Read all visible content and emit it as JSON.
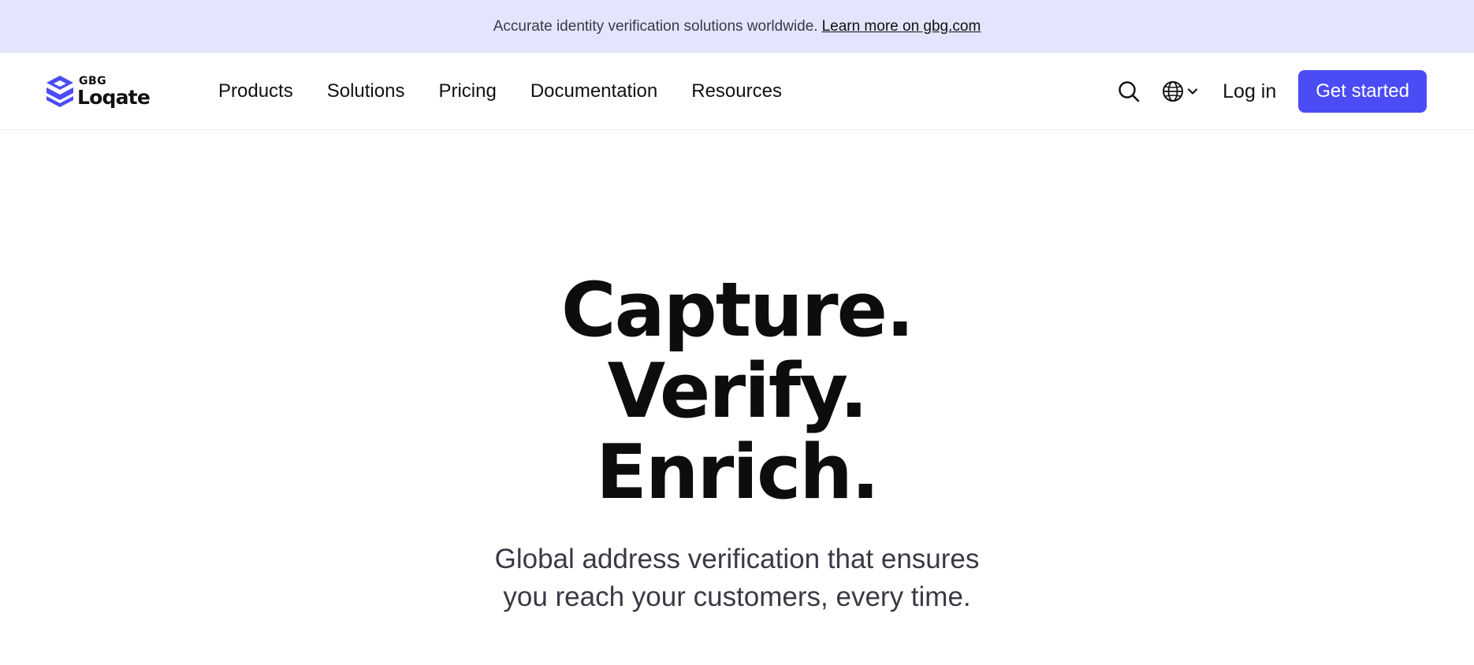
{
  "announcement": {
    "text": "Accurate identity verification solutions worldwide.",
    "link_label": "Learn more on gbg.com"
  },
  "header": {
    "logo": {
      "supertext": "GBG",
      "wordmark": "Loqate",
      "icon": "layered-cube-logo"
    },
    "nav": [
      {
        "label": "Products"
      },
      {
        "label": "Solutions"
      },
      {
        "label": "Pricing"
      },
      {
        "label": "Documentation"
      },
      {
        "label": "Resources"
      }
    ],
    "search_icon": "search-icon",
    "language_icon": "globe-icon",
    "language_chevron": "chevron-down-icon",
    "login_label": "Log in",
    "cta_label": "Get started"
  },
  "hero": {
    "headline": [
      "Capture.",
      "Verify.",
      "Enrich."
    ],
    "subheadline_line1": "Global address verification that ensures",
    "subheadline_line2": "you reach your customers, every time."
  },
  "colors": {
    "accent": "#4b4cf5",
    "announcement_bg": "#e3e4fd",
    "text_primary": "#111111",
    "text_secondary": "#3a3a44"
  }
}
